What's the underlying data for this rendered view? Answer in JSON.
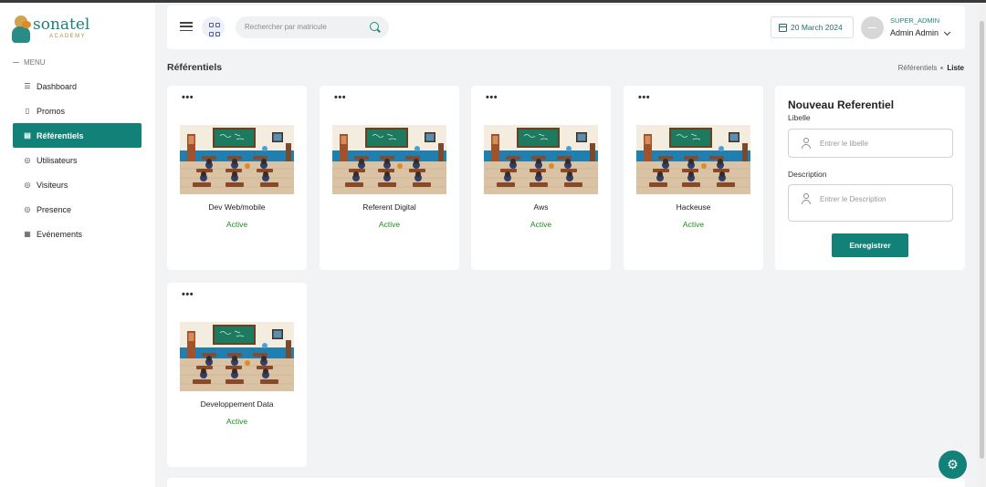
{
  "brand": {
    "name": "sonatel",
    "sub": "ACADEMY"
  },
  "menu_label": "MENU",
  "sidebar": {
    "items": [
      {
        "label": "Dashboard",
        "icon": "dashboard-icon"
      },
      {
        "label": "Promos",
        "icon": "promo-icon"
      },
      {
        "label": "Référentiels",
        "icon": "referentiel-icon",
        "active": true
      },
      {
        "label": "Utilisateurs",
        "icon": "user-icon"
      },
      {
        "label": "Visiteurs",
        "icon": "visitor-icon"
      },
      {
        "label": "Presence",
        "icon": "presence-icon"
      },
      {
        "label": "Evénements",
        "icon": "calendar-icon"
      }
    ]
  },
  "header": {
    "search_placeholder": "Rechercher par matricule",
    "date": "20 March 2024",
    "role": "SUPER_ADMIN",
    "user": "Admin Admin"
  },
  "page": {
    "title": "Référentiels",
    "breadcrumb": [
      "Référentiels",
      "Liste"
    ]
  },
  "cards": [
    {
      "name": "Dev Web/mobile",
      "status": "Active"
    },
    {
      "name": "Referent Digital",
      "status": "Active"
    },
    {
      "name": "Aws",
      "status": "Active"
    },
    {
      "name": "Hackeuse",
      "status": "Active"
    },
    {
      "name": "Developpement Data",
      "status": "Active"
    }
  ],
  "more_glyph": "•••",
  "form": {
    "title": "Nouveau Referentiel",
    "libelle_label": "Libelle",
    "libelle_placeholder": "Entrer le libelle",
    "description_label": "Description",
    "description_placeholder": "Entrer le Description",
    "submit": "Enregistrer"
  },
  "colors": {
    "primary": "#128278",
    "active_status": "#1e8c1e"
  }
}
